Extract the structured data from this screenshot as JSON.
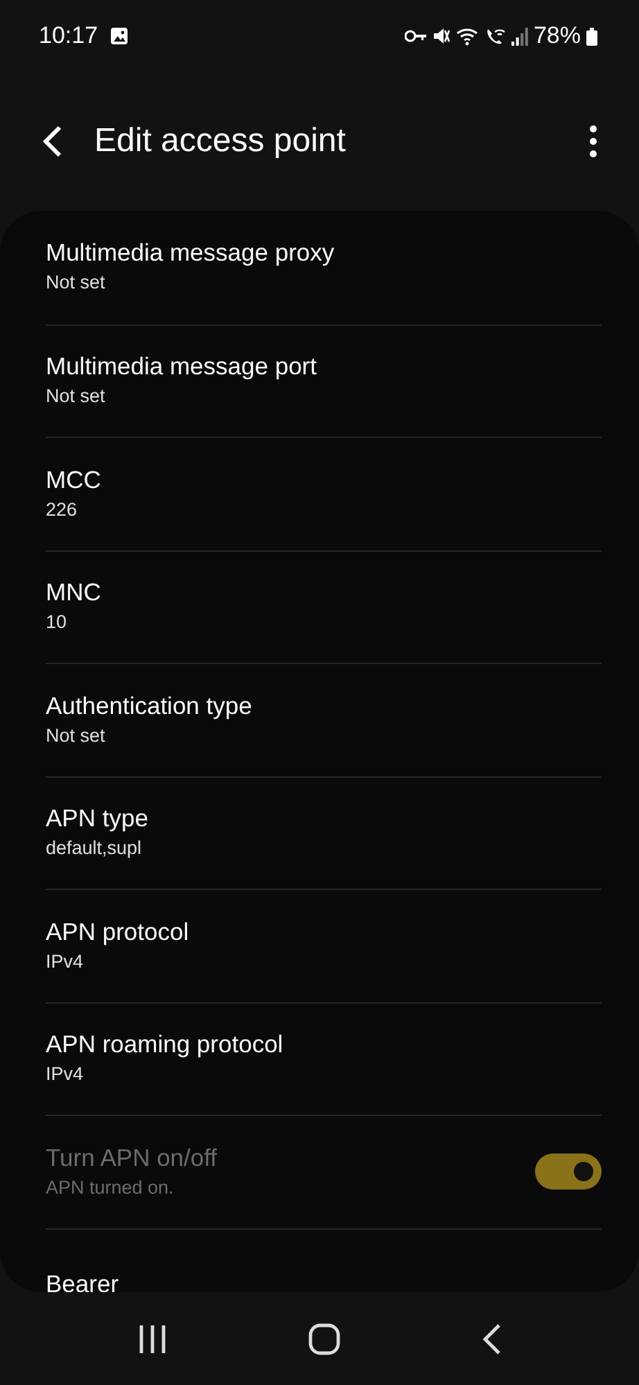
{
  "status_bar": {
    "time": "10:17",
    "battery": "78%"
  },
  "header": {
    "title": "Edit access point"
  },
  "rows": [
    {
      "kind": "text",
      "title": "Multimedia message proxy",
      "subtitle": "Not set"
    },
    {
      "kind": "text",
      "title": "Multimedia message port",
      "subtitle": "Not set"
    },
    {
      "kind": "text",
      "title": "MCC",
      "subtitle": "226"
    },
    {
      "kind": "text",
      "title": "MNC",
      "subtitle": "10"
    },
    {
      "kind": "text",
      "title": "Authentication type",
      "subtitle": "Not set"
    },
    {
      "kind": "text",
      "title": "APN type",
      "subtitle": "default,supl"
    },
    {
      "kind": "text",
      "title": "APN protocol",
      "subtitle": "IPv4"
    },
    {
      "kind": "text",
      "title": "APN roaming protocol",
      "subtitle": "IPv4"
    },
    {
      "kind": "toggle",
      "title": "Turn APN on/off",
      "subtitle": "APN turned on.",
      "on": true,
      "disabled": true
    },
    {
      "kind": "text",
      "title": "Bearer"
    }
  ]
}
